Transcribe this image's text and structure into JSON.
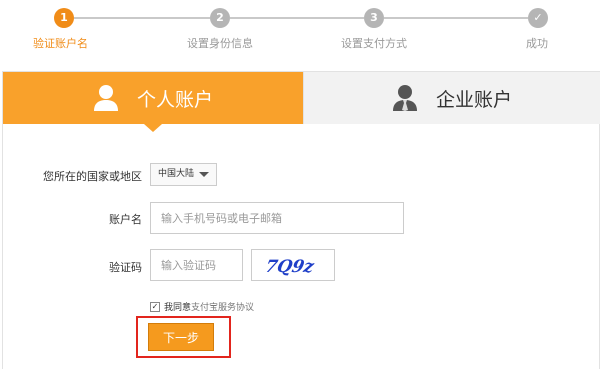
{
  "steps": [
    {
      "number": "1",
      "label": "验证账户名",
      "state": "active"
    },
    {
      "number": "2",
      "label": "设置身份信息",
      "state": "pending"
    },
    {
      "number": "3",
      "label": "设置支付方式",
      "state": "pending"
    },
    {
      "number": "✓",
      "label": "成功",
      "state": "pending"
    }
  ],
  "tabs": {
    "personal": "个人账户",
    "business": "企业账户"
  },
  "form": {
    "region_label": "您所在的国家或地区",
    "region_value": "中国大陆",
    "account_label": "账户名",
    "account_placeholder": "输入手机号码或电子邮箱",
    "captcha_label": "验证码",
    "captcha_placeholder": "输入验证码",
    "captcha_text": "7Q9z",
    "agree_text": "我同意",
    "agree_link": "支付宝服务协议",
    "agree_checked": "✓",
    "next_button": "下一步"
  },
  "colors": {
    "accent": "#f08c18",
    "tab_active": "#f9a12b",
    "highlight": "#e2251d",
    "captcha": "#1f3fc8"
  }
}
